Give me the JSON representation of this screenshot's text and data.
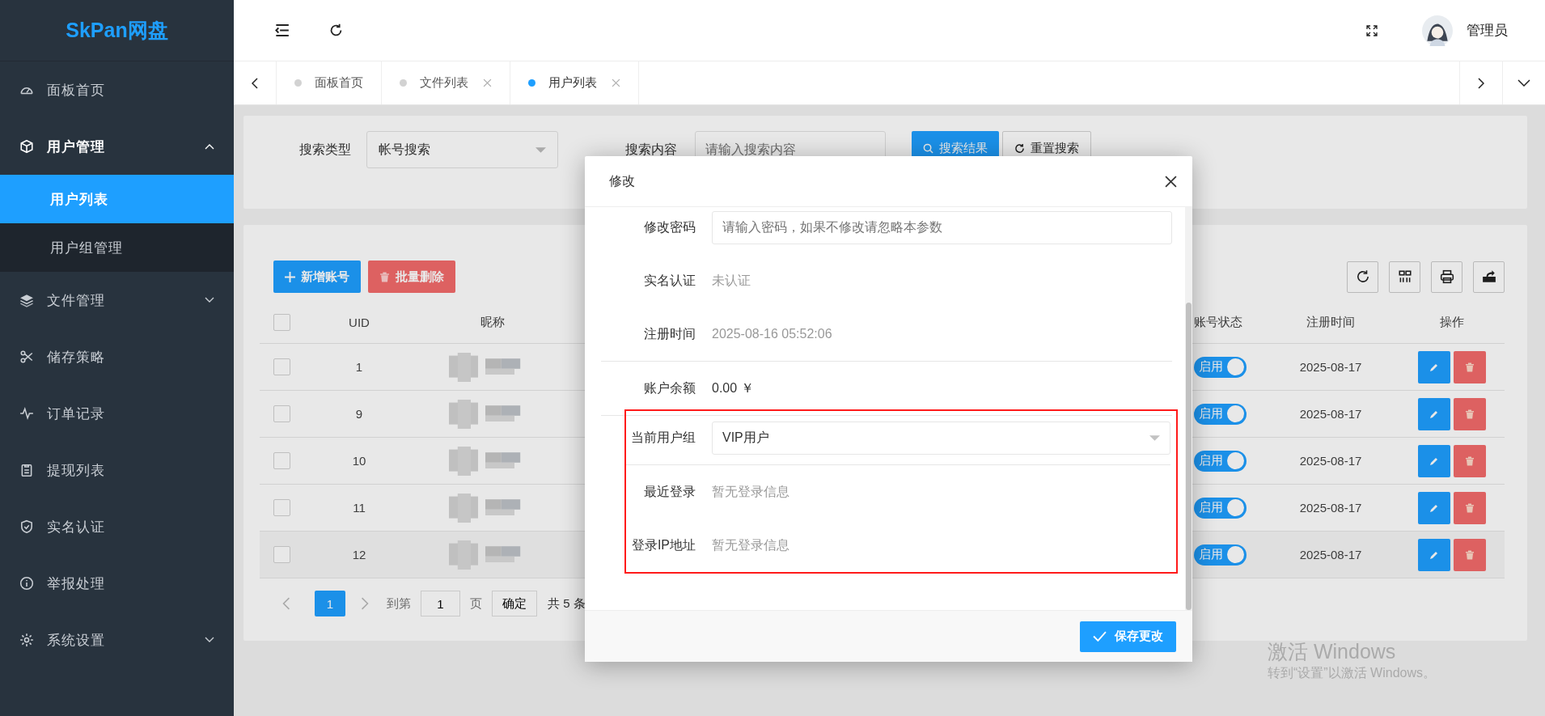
{
  "brand": "SkPan网盘",
  "sidebar": {
    "items": [
      {
        "label": "面板首页",
        "kind": "link",
        "selected": false
      },
      {
        "label": "用户管理",
        "kind": "group",
        "expanded": true,
        "selected": false,
        "children": [
          {
            "label": "用户列表",
            "selected": true
          },
          {
            "label": "用户组管理",
            "selected": false
          }
        ]
      },
      {
        "label": "文件管理",
        "kind": "group",
        "expanded": false,
        "selected": false
      },
      {
        "label": "储存策略",
        "kind": "link",
        "selected": false
      },
      {
        "label": "订单记录",
        "kind": "link",
        "selected": false
      },
      {
        "label": "提现列表",
        "kind": "link",
        "selected": false
      },
      {
        "label": "实名认证",
        "kind": "link",
        "selected": false
      },
      {
        "label": "举报处理",
        "kind": "link",
        "selected": false
      },
      {
        "label": "系统设置",
        "kind": "group",
        "expanded": false,
        "selected": false
      }
    ]
  },
  "header": {
    "user_name": "管理员"
  },
  "tabs": [
    {
      "label": "面板首页",
      "selected": false,
      "closable": false
    },
    {
      "label": "文件列表",
      "selected": false,
      "closable": true
    },
    {
      "label": "用户列表",
      "selected": true,
      "closable": true
    }
  ],
  "search": {
    "type_label": "搜索类型",
    "type_value": "帐号搜索",
    "content_label": "搜索内容",
    "content_placeholder": "请输入搜索内容",
    "buttons": [
      "搜索结果",
      "重置搜索"
    ]
  },
  "table": {
    "actions": [
      "新增账号",
      "批量删除"
    ],
    "columns": [
      "UID",
      "昵称",
      "账号状态",
      "注册时间",
      "操作"
    ],
    "all_checked": false,
    "rows": [
      {
        "uid": "1",
        "checked": false,
        "redacted": true,
        "status": "启用",
        "enabled": true,
        "date": "2025-08-17",
        "hovered": false
      },
      {
        "uid": "9",
        "checked": false,
        "redacted": true,
        "status": "启用",
        "enabled": true,
        "date": "2025-08-17",
        "hovered": false
      },
      {
        "uid": "10",
        "checked": false,
        "redacted": true,
        "status": "启用",
        "enabled": true,
        "date": "2025-08-17",
        "hovered": false
      },
      {
        "uid": "11",
        "checked": false,
        "redacted": true,
        "status": "启用",
        "enabled": true,
        "date": "2025-08-17",
        "hovered": false
      },
      {
        "uid": "12",
        "checked": false,
        "redacted": true,
        "status": "启用",
        "enabled": true,
        "date": "2025-08-17",
        "hovered": true
      }
    ],
    "pagination": {
      "current": "1",
      "goto_label": "到第",
      "page_input": "1",
      "page_suffix": "页",
      "confirm": "确定",
      "total": "共 5 条"
    }
  },
  "modal": {
    "title": "修改",
    "fields": [
      {
        "kind": "input",
        "label": "修改密码",
        "placeholder": "请输入密码，如果不修改请忽略本参数",
        "divider_before": false,
        "highlighted": false
      },
      {
        "kind": "text",
        "label": "实名认证",
        "value": "未认证",
        "muted": true,
        "divider_before": false,
        "highlighted": false
      },
      {
        "kind": "text",
        "label": "注册时间",
        "value": "2025-08-16 05:52:06",
        "muted": true,
        "divider_before": false,
        "highlighted": false
      },
      {
        "kind": "text",
        "label": "账户余额",
        "value": "0.00 ￥",
        "muted": false,
        "divider_before": true,
        "highlighted": false
      },
      {
        "kind": "select",
        "label": "当前用户组",
        "value": "VIP用户",
        "divider_before": true,
        "highlighted": true
      },
      {
        "kind": "text",
        "label": "最近登录",
        "value": "暂无登录信息",
        "muted": true,
        "divider_before": true,
        "highlighted": true
      },
      {
        "kind": "text",
        "label": "登录IP地址",
        "value": "暂无登录信息",
        "muted": true,
        "divider_before": false,
        "highlighted": true
      }
    ],
    "save_button": "保存更改"
  },
  "os_notice": {
    "title": "激活 Windows",
    "text": "转到“设置”以激活 Windows。"
  }
}
